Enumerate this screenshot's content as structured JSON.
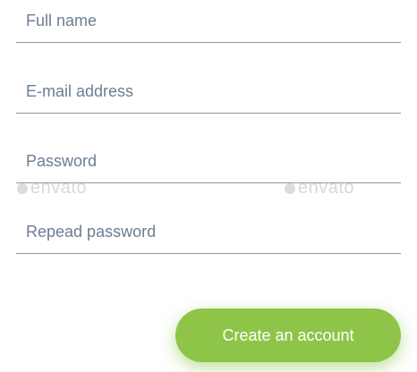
{
  "form": {
    "fields": [
      {
        "placeholder": "Full name",
        "value": ""
      },
      {
        "placeholder": "E-mail address",
        "value": ""
      },
      {
        "placeholder": "Password",
        "value": ""
      },
      {
        "placeholder": "Repead password",
        "value": ""
      }
    ],
    "submit_label": "Create an account"
  },
  "watermark": {
    "text": "envato"
  },
  "colors": {
    "accent": "#8ec549",
    "field_line": "#8a97ad",
    "placeholder_text": "#6d7d94",
    "background": "#ffffff"
  }
}
